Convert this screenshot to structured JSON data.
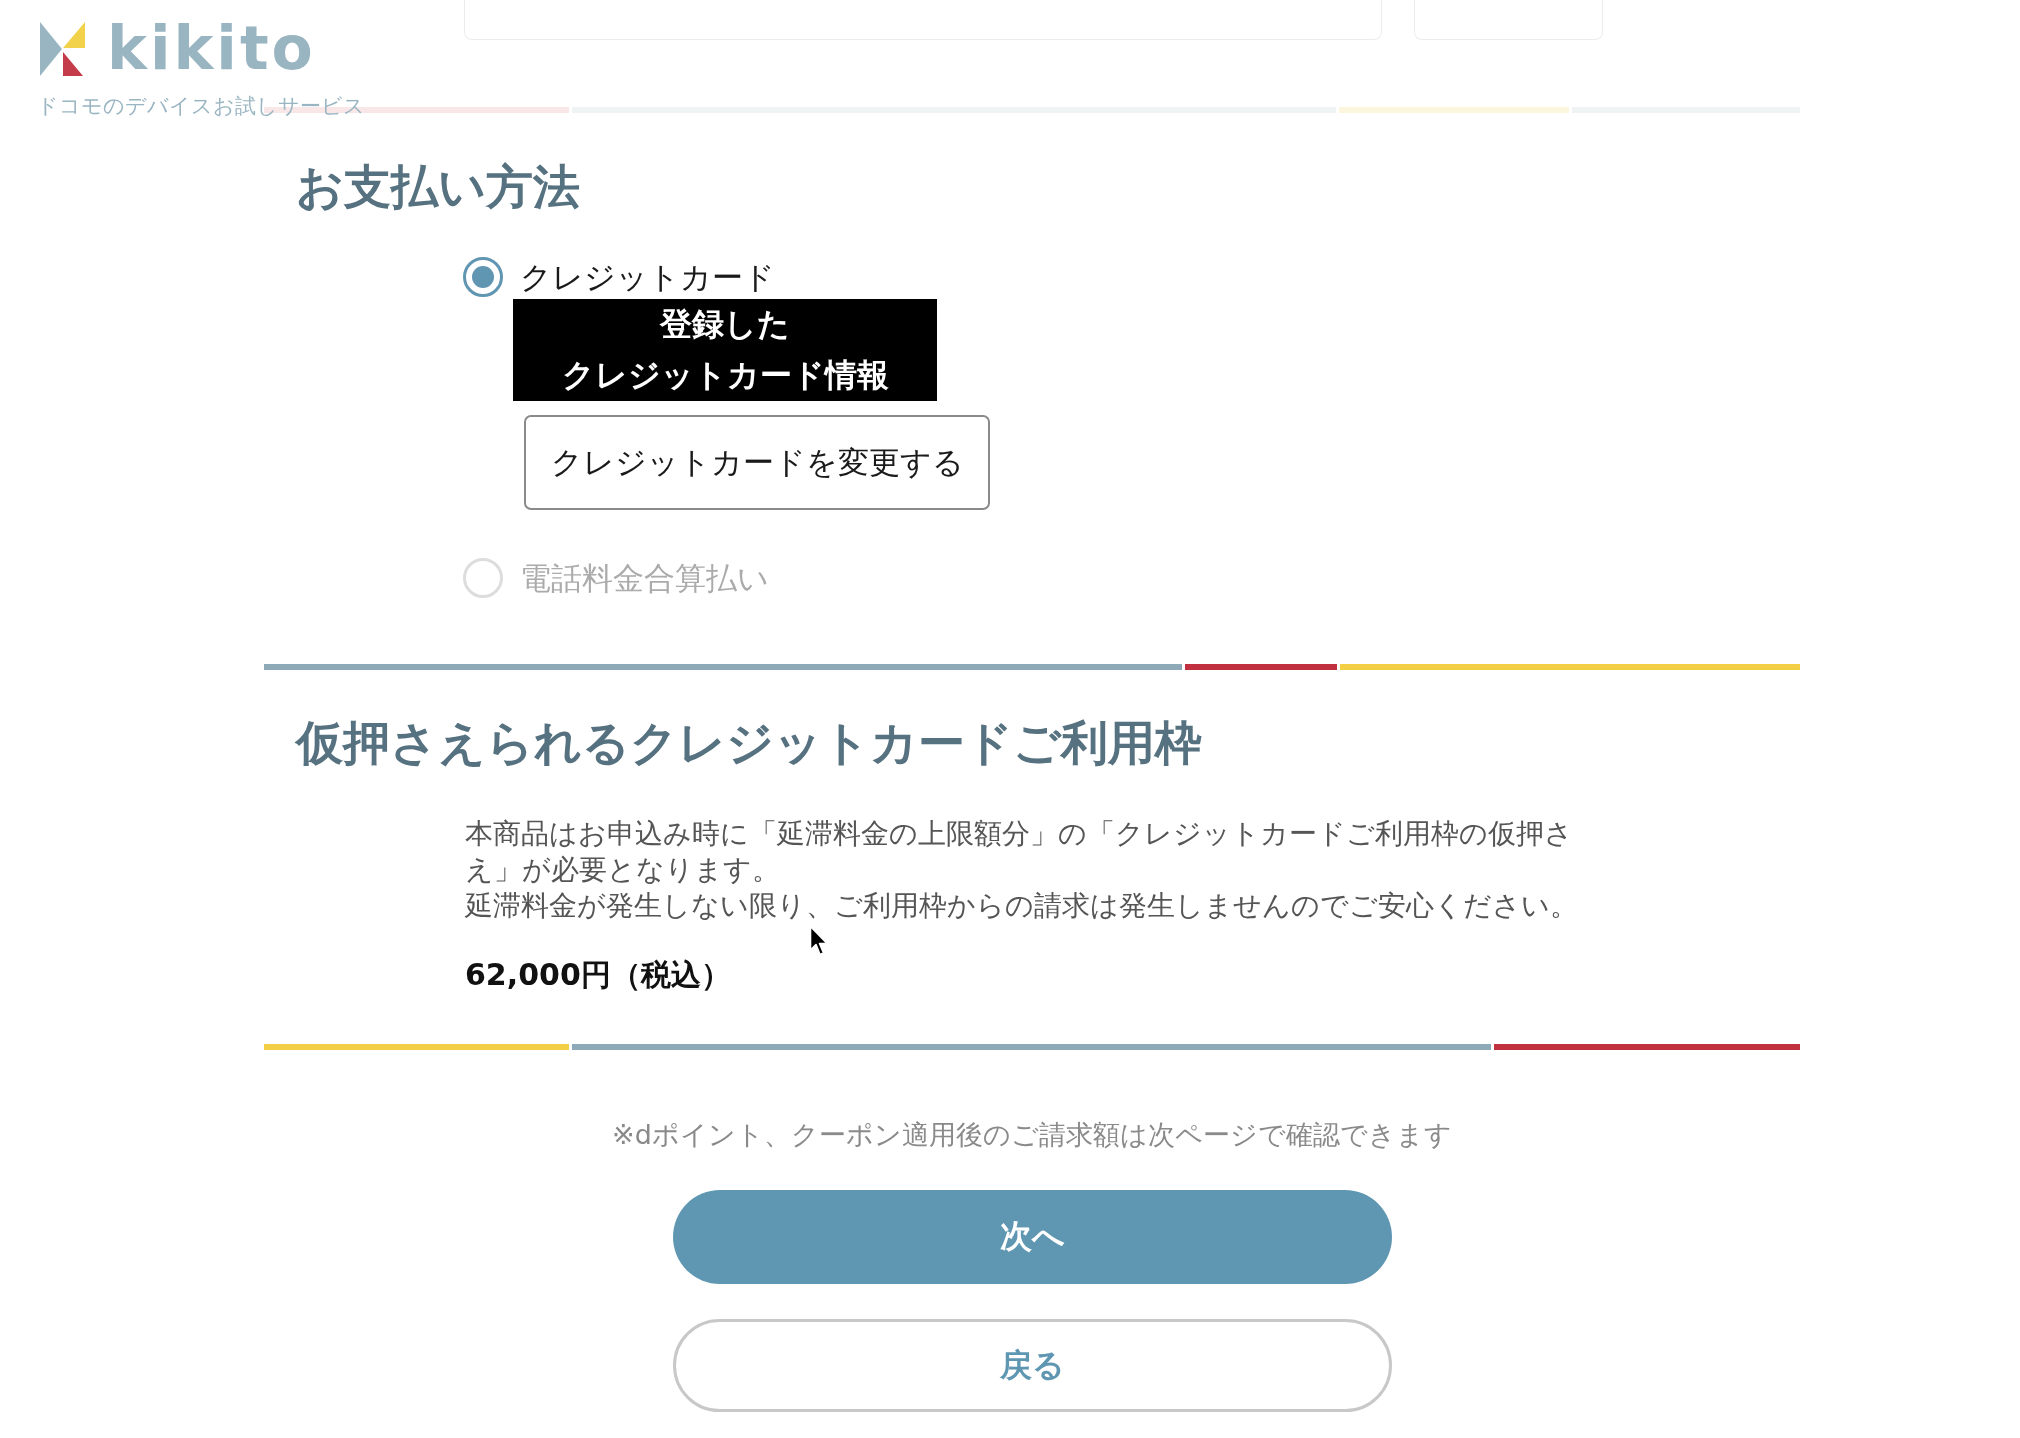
{
  "header": {
    "logo": "kikito",
    "tagline": "ドコモのデバイスお試しサービス"
  },
  "payment": {
    "title": "お支払い方法",
    "options": [
      {
        "label": "クレジットカード",
        "selected": true,
        "disabled": false,
        "registered_card": [
          "登録した",
          "クレジットカード情報"
        ],
        "change_button": "クレジットカードを変更する"
      },
      {
        "label": "電話料金合算払い",
        "selected": false,
        "disabled": true
      }
    ]
  },
  "credit_hold": {
    "title": "仮押さえられるクレジットカードご利用枠",
    "lines": [
      "本商品はお申込み時に「延滞料金の上限額分」の「クレジットカードご利用枠の仮押さえ」が必要となります。",
      "延滞料金が発生しない限り、ご利用枠からの請求は発生しませんのでご安心ください。"
    ],
    "amount": "62,000円（税込）"
  },
  "note": "※dポイント、クーポン適用後のご請求額は次ページで確認できます",
  "buttons": [
    {
      "label": "次へ",
      "kind": "primary"
    },
    {
      "label": "戻る",
      "kind": "secondary"
    }
  ]
}
